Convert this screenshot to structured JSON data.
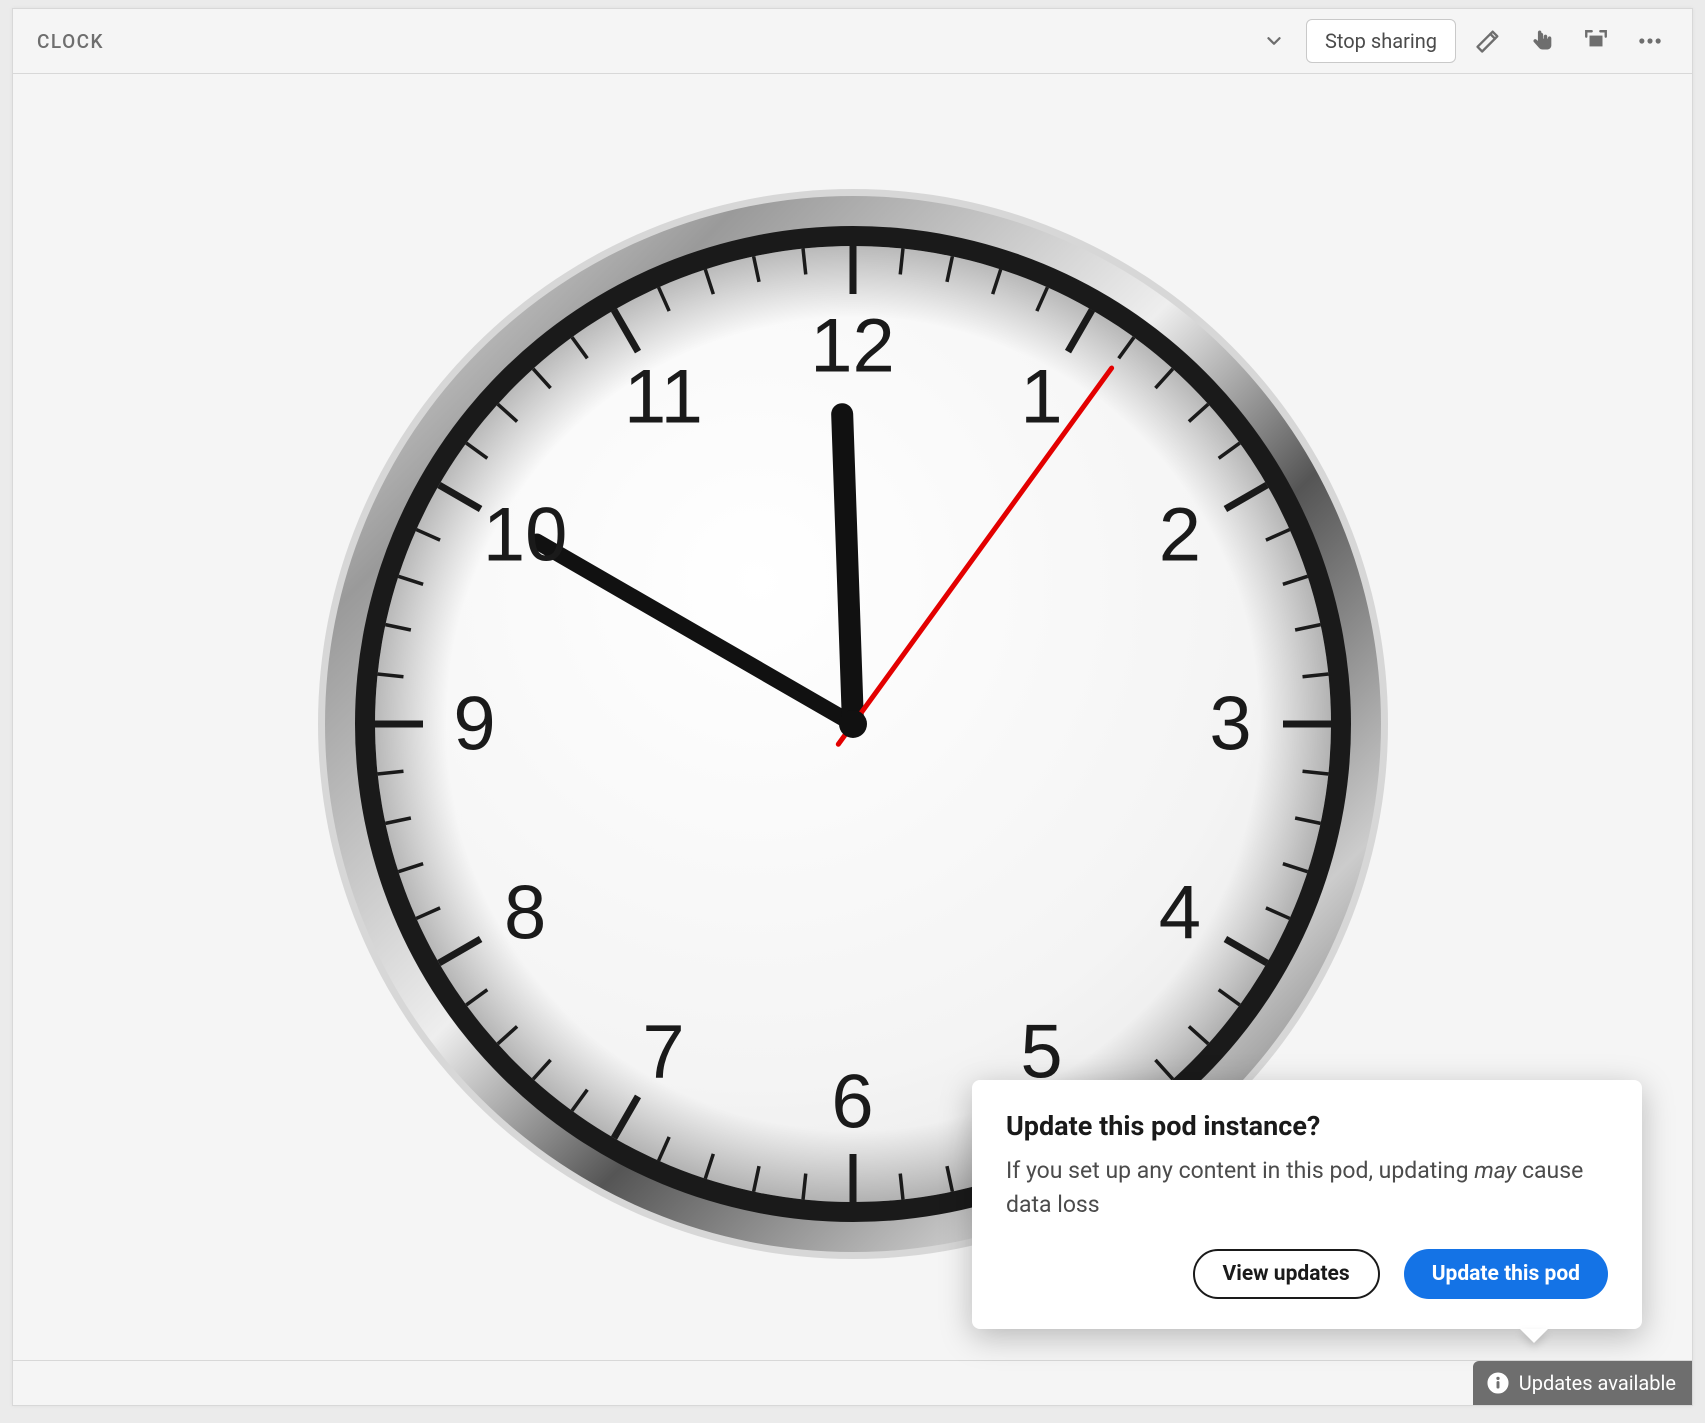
{
  "pod": {
    "title": "CLOCK"
  },
  "toolbar": {
    "stop_sharing_label": "Stop sharing"
  },
  "clock": {
    "numerals": [
      "12",
      "1",
      "2",
      "3",
      "4",
      "5",
      "6",
      "7",
      "8",
      "9",
      "10",
      "11"
    ],
    "hour_hand_angle_deg": -2,
    "minute_hand_angle_deg": -60,
    "second_hand_angle_deg": 36
  },
  "popover": {
    "title": "Update this pod instance?",
    "body_prefix": "If you set up any content in this pod, updating ",
    "body_em": "may",
    "body_suffix": " cause data loss",
    "view_updates_label": "View updates",
    "update_pod_label": "Update this pod"
  },
  "status": {
    "label": "Updates available"
  },
  "colors": {
    "primary": "#1473e6",
    "second_hand": "#e30000",
    "chip": "#6e6e6e"
  }
}
